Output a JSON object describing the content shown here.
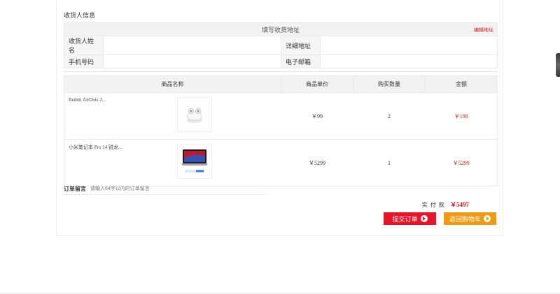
{
  "receiver": {
    "section_title": "收货人信息",
    "header": "填写收货地址",
    "edit_link": "编辑地址",
    "name_label": "收货人姓名",
    "name_value": "",
    "address_label": "详细地址",
    "address_value": "",
    "phone_label": "手机号码",
    "phone_value": "",
    "email_label": "电子邮箱",
    "email_value": ""
  },
  "goods": {
    "columns": [
      "商品名称",
      "商品单价",
      "购买数量",
      "金额"
    ],
    "items": [
      {
        "name": "Redmi AirDots 2...",
        "price": "￥99",
        "qty": "2",
        "amount": "￥198",
        "icon": "earbuds-icon"
      },
      {
        "name": "小米笔记本 Pro 14 锐龙...",
        "price": "￥5299",
        "qty": "1",
        "amount": "￥5299",
        "icon": "laptop-icon"
      }
    ]
  },
  "note": {
    "label": "订单留言",
    "placeholder": "请输入64字以内的订单留言"
  },
  "total": {
    "label": "实付款",
    "value": "￥5497"
  },
  "buttons": {
    "submit": "提交订单",
    "back": "返回购物车"
  },
  "colors": {
    "accent_red": "#d8141b",
    "submit_bg": "#e5142a",
    "back_bg": "#ee9a12"
  }
}
